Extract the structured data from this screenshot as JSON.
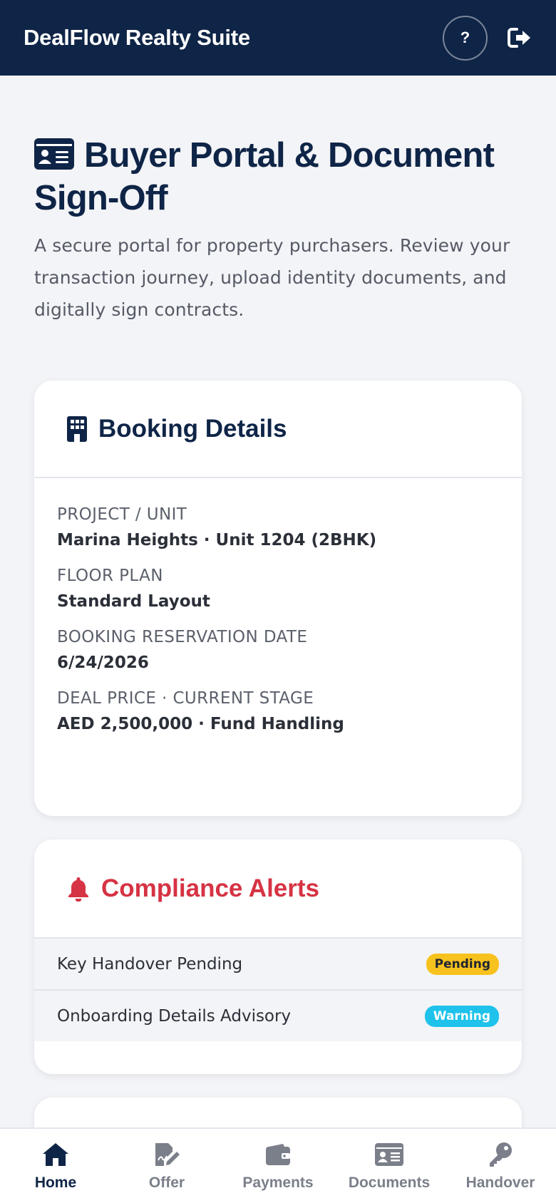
{
  "app": {
    "brand": "DealFlow Realty Suite",
    "help_label": "?"
  },
  "page": {
    "title": "Buyer Portal & Document Sign-Off",
    "subtitle": "A secure portal for property purchasers. Review your transaction journey, upload identity documents, and digitally sign contracts."
  },
  "booking": {
    "heading": "Booking Details",
    "fields": [
      {
        "label": "Project / Unit",
        "value": "Marina Heights · Unit 1204 (2BHK)"
      },
      {
        "label": "Floor Plan",
        "value": "Standard Layout"
      },
      {
        "label": "Booking Reservation Date",
        "value": "6/24/2026"
      },
      {
        "label": "Deal Price · Current Stage",
        "value": "AED 2,500,000 · Fund Handling"
      }
    ]
  },
  "alerts": {
    "heading": "Compliance Alerts",
    "items": [
      {
        "text": "Key Handover Pending",
        "status": "Pending"
      },
      {
        "text": "Onboarding Details Advisory",
        "status": "Warning"
      }
    ]
  },
  "nav": {
    "items": [
      {
        "label": "Home",
        "icon": "home-icon",
        "active": true
      },
      {
        "label": "Offer",
        "icon": "signature-icon"
      },
      {
        "label": "Payments",
        "icon": "wallet-icon"
      },
      {
        "label": "Documents",
        "icon": "id-card-icon"
      },
      {
        "label": "Handover",
        "icon": "key-icon"
      }
    ]
  },
  "colors": {
    "navy": "#0f2547",
    "alert_red": "#d63344",
    "pending": "#f7c21d",
    "warning": "#1ec2ea"
  }
}
